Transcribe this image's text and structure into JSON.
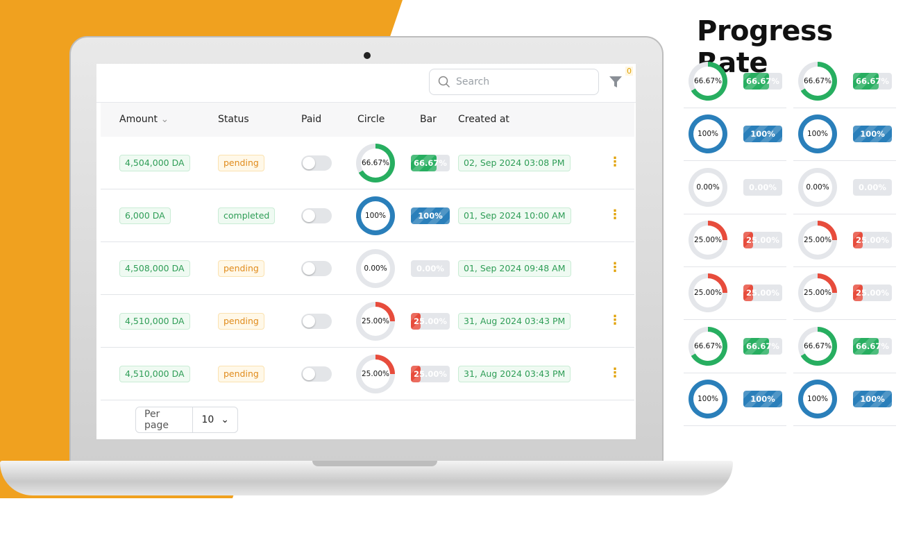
{
  "colors": {
    "accent": "#f0a11f",
    "green": "#27ae60",
    "blue": "#2a7fba",
    "red": "#e74c3c",
    "track": "#e4e6ea"
  },
  "showcase_title": "Progress Rate",
  "toolbar": {
    "search_placeholder": "Search",
    "filter_count": "0",
    "search_icon": "search-icon",
    "filter_icon": "funnel-icon"
  },
  "table": {
    "headers": {
      "amount": "Amount",
      "status": "Status",
      "paid": "Paid",
      "circle": "Circle",
      "bar": "Bar",
      "created": "Created at"
    },
    "rows": [
      {
        "amount": "4,504,000 DA",
        "status": "pending",
        "paid": false,
        "progress": 66.67,
        "label": "66.67%",
        "color": "green",
        "created": "02, Sep 2024 03:08 PM"
      },
      {
        "amount": "6,000 DA",
        "status": "completed",
        "paid": false,
        "progress": 100,
        "label": "100%",
        "color": "blue",
        "created": "01, Sep 2024 10:00 AM"
      },
      {
        "amount": "4,508,000 DA",
        "status": "pending",
        "paid": false,
        "progress": 0,
        "label": "0.00%",
        "color": "track",
        "created": "01, Sep 2024 09:48 AM"
      },
      {
        "amount": "4,510,000 DA",
        "status": "pending",
        "paid": false,
        "progress": 25,
        "label": "25.00%",
        "color": "red",
        "created": "31, Aug 2024 03:43 PM"
      },
      {
        "amount": "4,510,000 DA",
        "status": "pending",
        "paid": false,
        "progress": 25,
        "label": "25.00%",
        "color": "red",
        "created": "31, Aug 2024 03:43 PM"
      }
    ]
  },
  "pagination": {
    "label": "Per page",
    "value": "10"
  },
  "showcase": [
    {
      "progress": 66.67,
      "label": "66.67%",
      "color": "green"
    },
    {
      "progress": 100,
      "label": "100%",
      "color": "blue"
    },
    {
      "progress": 0,
      "label": "0.00%",
      "color": "track"
    },
    {
      "progress": 25,
      "label": "25.00%",
      "color": "red"
    },
    {
      "progress": 25,
      "label": "25.00%",
      "color": "red"
    },
    {
      "progress": 66.67,
      "label": "66.67%",
      "color": "green"
    },
    {
      "progress": 100,
      "label": "100%",
      "color": "blue"
    }
  ]
}
